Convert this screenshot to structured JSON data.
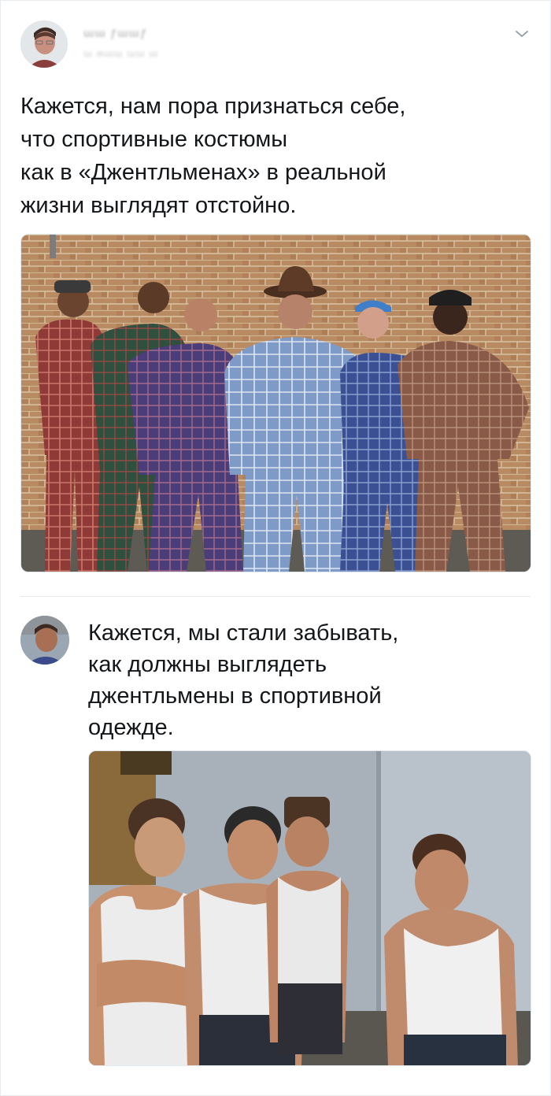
{
  "main_tweet": {
    "author_name": "ɯɯ ƒɯɯƒ",
    "author_handle": "ɯ ʍɯɯ ɯɯ ɯ",
    "text_lines": [
      "Кажется, нам пора признаться себе,",
      "что спортивные костюмы",
      "как в «Джентльменах» в реальной",
      "жизни выглядят отстойно."
    ],
    "menu_icon": "chevron-down-icon"
  },
  "reply_tweet": {
    "text_lines": [
      "Кажется, мы стали забывать,",
      "как должны выглядеть",
      "джентльмены в спортивной",
      "одежде."
    ]
  },
  "colors": {
    "text": "#14171a",
    "border": "#e6ecf0",
    "chevron": "#8899a6"
  }
}
